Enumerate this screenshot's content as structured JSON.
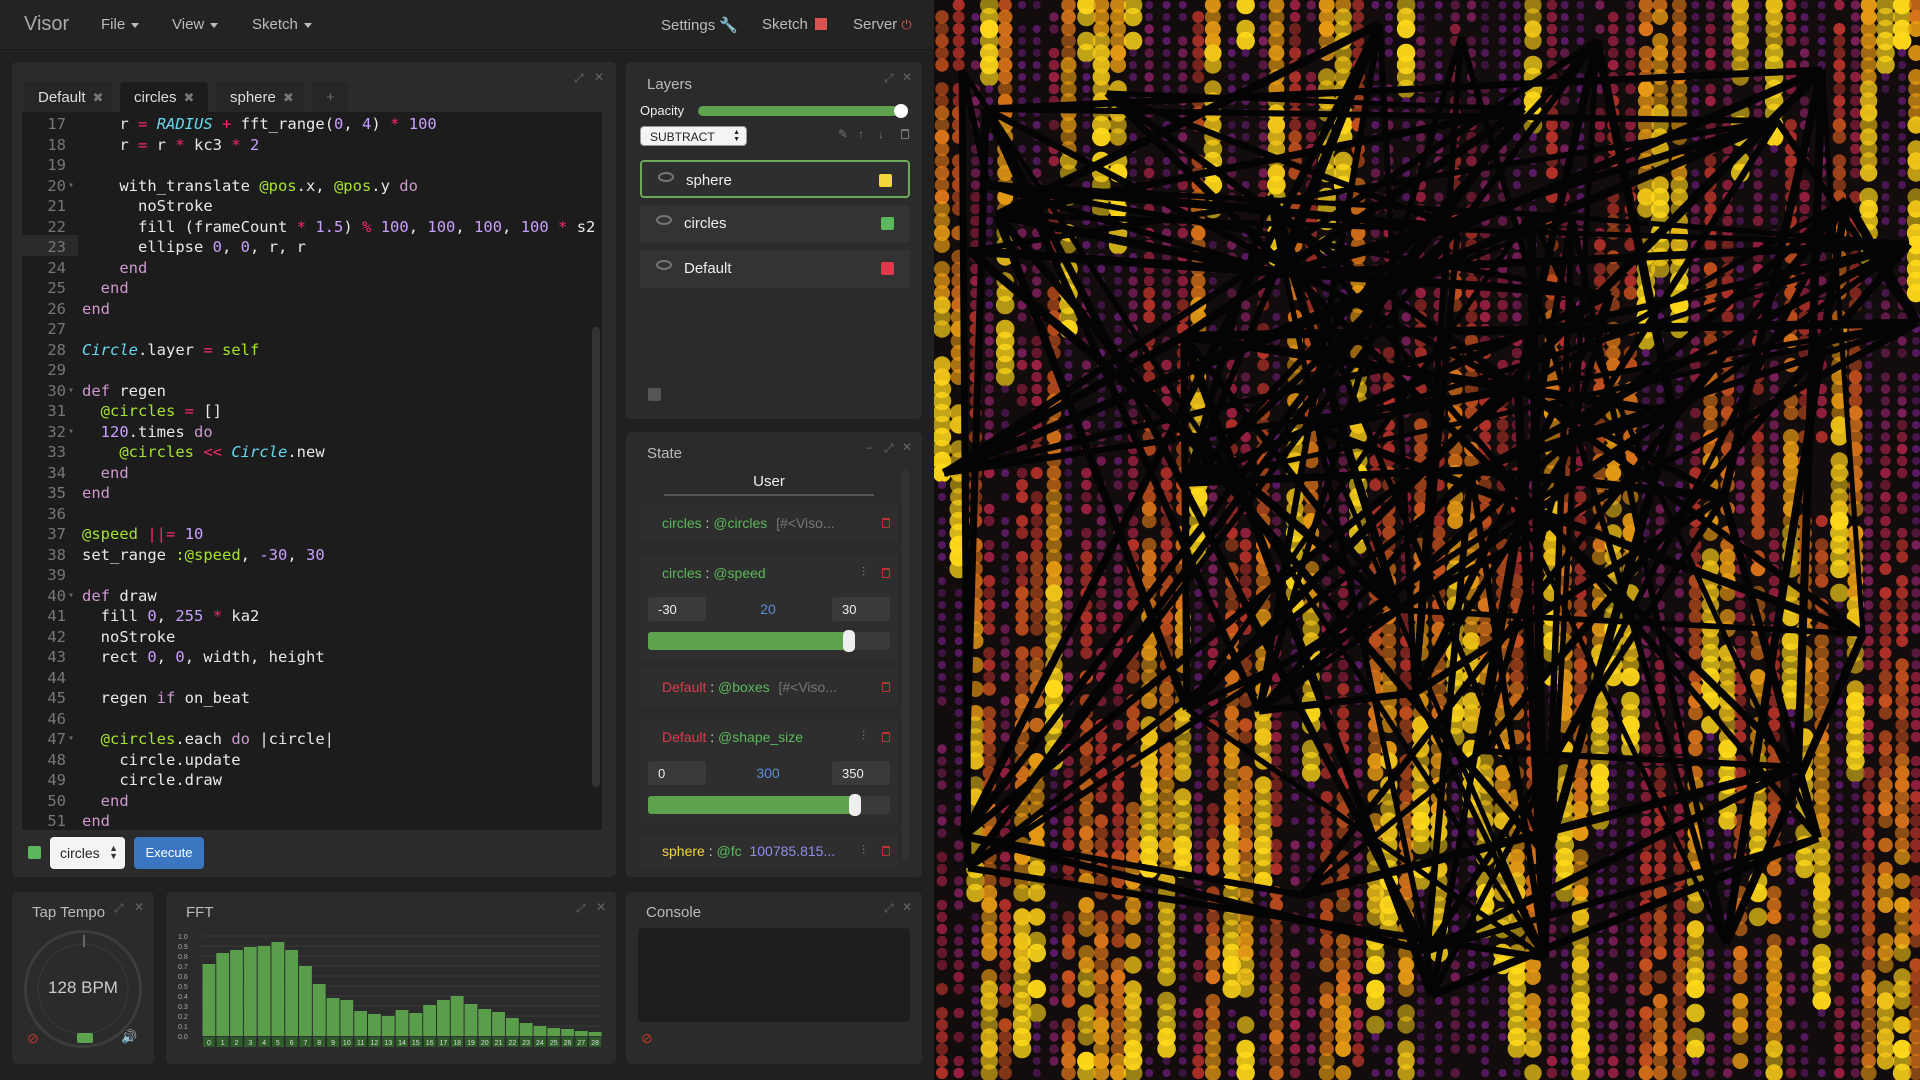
{
  "app": {
    "brand": "Visor",
    "menus": [
      "File",
      "View",
      "Sketch"
    ],
    "right_menus": [
      "Settings",
      "Sketch",
      "Server"
    ]
  },
  "editor": {
    "tabs": [
      {
        "label": "Default"
      },
      {
        "label": "circles"
      },
      {
        "label": "sphere"
      }
    ],
    "add_tab": "+",
    "layer_select": "circles",
    "execute_label": "Execute",
    "lines": [
      {
        "n": "17",
        "html": "    r <o>=</o> <i>RADIUS</i> <o>+</o> fft_range(<n>0</n>, <n>4</n>) <o>*</o> <n>100</n>"
      },
      {
        "n": "18",
        "html": "    r <o>=</o> r <o>*</o> kc3 <o>*</o> <n>2</n>"
      },
      {
        "n": "19",
        "html": ""
      },
      {
        "n": "20",
        "html": "    with_translate <s>@pos</s>.x, <s>@pos</s>.y <k>do</k>",
        "fold": true
      },
      {
        "n": "21",
        "html": "      noStroke"
      },
      {
        "n": "22",
        "html": "      fill (frameCount <o>*</o> <n>1.5</n>) <o>%</o> <n>100</n>, <n>100</n>, <n>100</n>, <n>100</n> <o>*</o> s2"
      },
      {
        "n": "23",
        "html": "      ellipse <n>0</n>, <n>0</n>, r, r"
      },
      {
        "n": "24",
        "html": "    <k>end</k>"
      },
      {
        "n": "25",
        "html": "  <k>end</k>"
      },
      {
        "n": "26",
        "html": "<k>end</k>"
      },
      {
        "n": "27",
        "html": ""
      },
      {
        "n": "28",
        "html": "<i>Circle</i>.layer <o>=</o> <s>self</s>"
      },
      {
        "n": "29",
        "html": ""
      },
      {
        "n": "30",
        "html": "<k>def</k> regen",
        "fold": true
      },
      {
        "n": "31",
        "html": "  <s>@circles</s> <o>=</o> []"
      },
      {
        "n": "32",
        "html": "  <n>120</n>.times <k>do</k>",
        "fold": true
      },
      {
        "n": "33",
        "html": "    <s>@circles</s> <o><<</o> <i>Circle</i>.new"
      },
      {
        "n": "34",
        "html": "  <k>end</k>"
      },
      {
        "n": "35",
        "html": "<k>end</k>"
      },
      {
        "n": "36",
        "html": ""
      },
      {
        "n": "37",
        "html": "<s>@speed</s> <o>||=</o> <n>10</n>"
      },
      {
        "n": "38",
        "html": "set_range <s>:@speed</s>, <n>-30</n>, <n>30</n>"
      },
      {
        "n": "39",
        "html": ""
      },
      {
        "n": "40",
        "html": "<k>def</k> draw",
        "fold": true
      },
      {
        "n": "41",
        "html": "  fill <n>0</n>, <n>255</n> <o>*</o> ka2"
      },
      {
        "n": "42",
        "html": "  noStroke"
      },
      {
        "n": "43",
        "html": "  rect <n>0</n>, <n>0</n>, width, height"
      },
      {
        "n": "44",
        "html": ""
      },
      {
        "n": "45",
        "html": "  regen <k>if</k> on_beat"
      },
      {
        "n": "46",
        "html": ""
      },
      {
        "n": "47",
        "html": "  <s>@circles</s>.each <k>do</k> |circle|",
        "fold": true
      },
      {
        "n": "48",
        "html": "    circle.update"
      },
      {
        "n": "49",
        "html": "    circle.draw"
      },
      {
        "n": "50",
        "html": "  <k>end</k>"
      },
      {
        "n": "51",
        "html": "<k>end</k>"
      }
    ]
  },
  "layers": {
    "title": "Layers",
    "opacity_label": "Opacity",
    "opacity_level": 1.0,
    "blend_mode": "SUBTRACT",
    "items": [
      {
        "name": "sphere",
        "color": "#f5d63a",
        "selected": true
      },
      {
        "name": "circles",
        "color": "#5cb85c",
        "selected": false
      },
      {
        "name": "Default",
        "color": "#e0384b",
        "selected": false
      }
    ]
  },
  "state": {
    "title": "State",
    "tab_user": "User",
    "rows": {
      "r1": {
        "layer": "circles",
        "sep": " : ",
        "var": "@circles",
        "value": "[#<Viso..."
      },
      "r2": {
        "layer": "circles",
        "sep": " : ",
        "var": "@speed",
        "min": "-30",
        "current": "20",
        "max": "30",
        "level": 0.83
      },
      "r3": {
        "layer": "Default",
        "sep": " : ",
        "var": "@boxes",
        "value": "[#<Viso..."
      },
      "r4": {
        "layer": "Default",
        "sep": " : ",
        "var": "@shape_size",
        "min": "0",
        "current": "300",
        "max": "350",
        "level": 0.857
      },
      "r5": {
        "layer": "sphere",
        "sep": " : ",
        "var": "@fc",
        "value": "100785.815..."
      }
    }
  },
  "tap_tempo": {
    "title": "Tap Tempo",
    "bpm": "128 BPM"
  },
  "fft": {
    "title": "FFT",
    "y_ticks": [
      "1.0",
      "0.9",
      "0.8",
      "0.7",
      "0.6",
      "0.5",
      "0.4",
      "0.3",
      "0.2",
      "0.1",
      "0.0"
    ],
    "bins": [
      "0",
      "1",
      "2",
      "3",
      "4",
      "5",
      "6",
      "7",
      "8",
      "9",
      "10",
      "11",
      "12",
      "13",
      "14",
      "15",
      "16",
      "17",
      "18",
      "19",
      "20",
      "21",
      "22",
      "23",
      "24",
      "25",
      "26",
      "27",
      "28"
    ],
    "values": [
      0.72,
      0.83,
      0.86,
      0.89,
      0.9,
      0.94,
      0.86,
      0.7,
      0.52,
      0.38,
      0.36,
      0.25,
      0.22,
      0.2,
      0.26,
      0.23,
      0.31,
      0.36,
      0.4,
      0.32,
      0.27,
      0.24,
      0.18,
      0.13,
      0.1,
      0.08,
      0.07,
      0.05,
      0.04
    ]
  },
  "console": {
    "title": "Console"
  },
  "colors": {
    "accent": "#3b76c3",
    "green": "#5da24c",
    "danger": "#d9534f"
  }
}
